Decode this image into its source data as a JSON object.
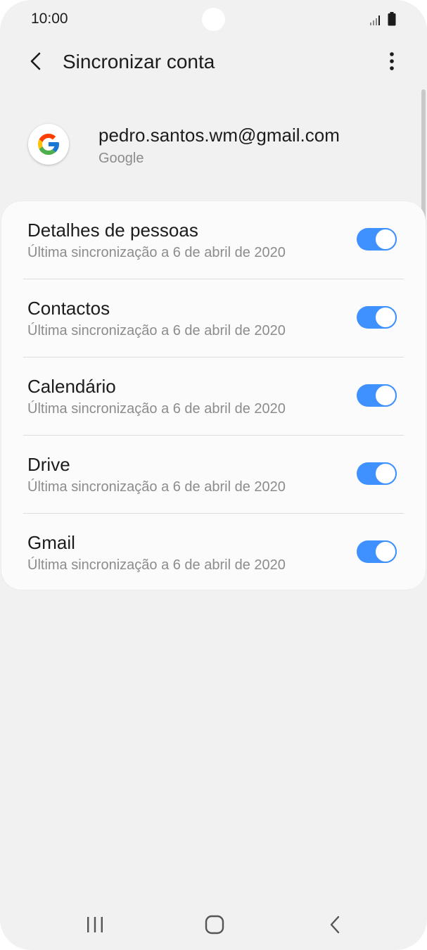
{
  "status_bar": {
    "time": "10:00"
  },
  "header": {
    "title": "Sincronizar conta",
    "back_icon": "chevron-left-icon",
    "more_icon": "more-vert-icon"
  },
  "account": {
    "email": "pedro.santos.wm@gmail.com",
    "provider": "Google",
    "logo": "google-logo"
  },
  "sync_items": [
    {
      "title": "Detalhes de pessoas",
      "subtitle": "Última sincronização a 6 de abril de 2020",
      "enabled": true
    },
    {
      "title": "Contactos",
      "subtitle": "Última sincronização a 6 de abril de 2020",
      "enabled": true
    },
    {
      "title": "Calendário",
      "subtitle": "Última sincronização a 6 de abril de 2020",
      "enabled": true
    },
    {
      "title": "Drive",
      "subtitle": "Última sincronização a 6 de abril de 2020",
      "enabled": true
    },
    {
      "title": "Gmail",
      "subtitle": "Última sincronização a 6 de abril de 2020",
      "enabled": true
    }
  ],
  "colors": {
    "accent": "#3e91ff",
    "background": "#f1f1f1",
    "card": "#fbfbfb"
  },
  "nav_bar": {
    "icons": [
      "recent-apps-icon",
      "home-icon",
      "back-icon"
    ]
  }
}
